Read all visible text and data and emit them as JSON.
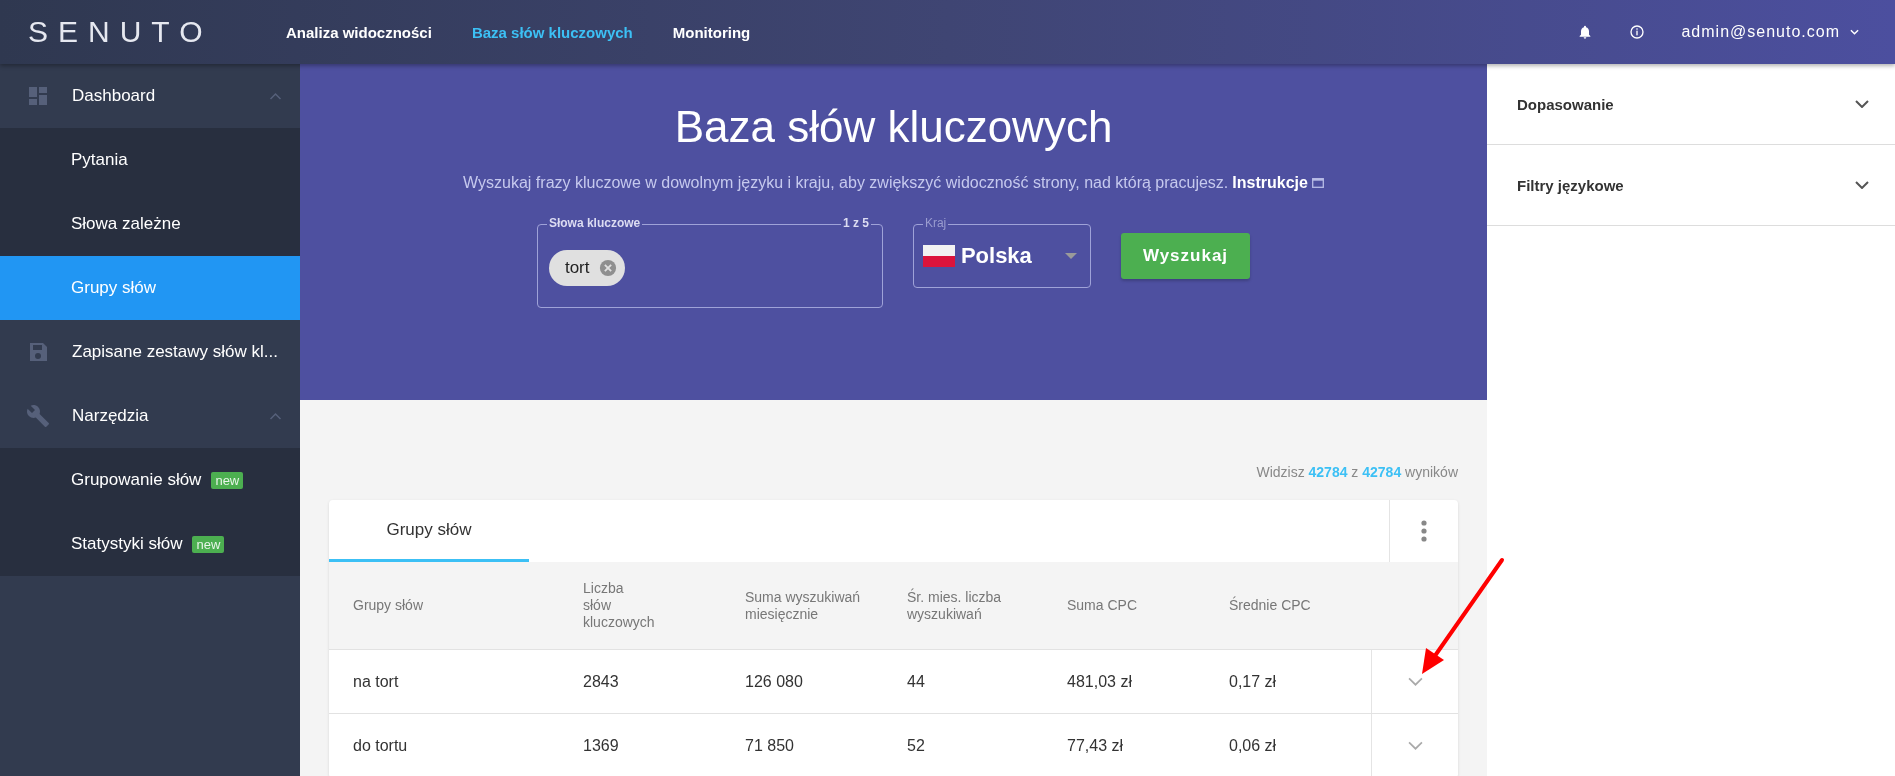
{
  "topbar": {
    "logo": "SENUTO",
    "nav": [
      {
        "label": "Analiza widoczności",
        "selected": false
      },
      {
        "label": "Baza słów kluczowych",
        "selected": true
      },
      {
        "label": "Monitoring",
        "selected": false
      }
    ],
    "user": "admin@senuto.com"
  },
  "sidebar": {
    "items": [
      {
        "label": "Dashboard",
        "kind": "dashboard",
        "expanded": true,
        "children": [
          {
            "label": "Pytania",
            "selected": false
          },
          {
            "label": "Słowa zależne",
            "selected": false
          },
          {
            "label": "Grupy słów",
            "selected": true
          }
        ]
      },
      {
        "label": "Zapisane zestawy słów kl...",
        "kind": "saved"
      },
      {
        "label": "Narzędzia",
        "kind": "tools",
        "expanded": true,
        "children": [
          {
            "label": "Grupowanie słów",
            "selected": false,
            "badge": "new"
          },
          {
            "label": "Statystyki słów",
            "selected": false,
            "badge": "new"
          }
        ]
      }
    ]
  },
  "hero": {
    "title": "Baza słów kluczowych",
    "subtitle": "Wyszukaj frazy kluczowe w dowolnym języku i kraju, aby zwiększyć widoczność strony, nad którą pracujesz.",
    "link": "Instrukcje",
    "keywords_field": {
      "label": "Słowa kluczowe",
      "counter": "1 z 5",
      "chips": [
        "tort"
      ]
    },
    "country_field": {
      "label": "Kraj",
      "value": "Polska"
    },
    "search_button": "Wyszukaj"
  },
  "results": {
    "prefix": "Widzisz",
    "shown": "42784",
    "middle": "z",
    "total": "42784",
    "suffix": "wyników"
  },
  "table": {
    "tabs": [
      {
        "label": "Grupy słów",
        "selected": true
      }
    ],
    "columns": [
      "Grupy słów",
      "Liczba\nsłów\nkluczowych",
      "Suma wyszukiwań\nmiesięcznie",
      "Śr. mies. liczba\nwyszukiwań",
      "Suma CPC",
      "Średnie CPC"
    ],
    "rows": [
      {
        "cells": [
          "na tort",
          "2843",
          "126 080",
          "44",
          "481,03 zł",
          "0,17 zł"
        ],
        "expanded": false
      },
      {
        "cells": [
          "do tortu",
          "1369",
          "71 850",
          "52",
          "77,43 zł",
          "0,06 zł"
        ],
        "expanded": false
      }
    ]
  },
  "filters": [
    {
      "label": "Dopasowanie",
      "expanded": false
    },
    {
      "label": "Filtry językowe",
      "expanded": false
    }
  ],
  "annotation_arrow": true
}
